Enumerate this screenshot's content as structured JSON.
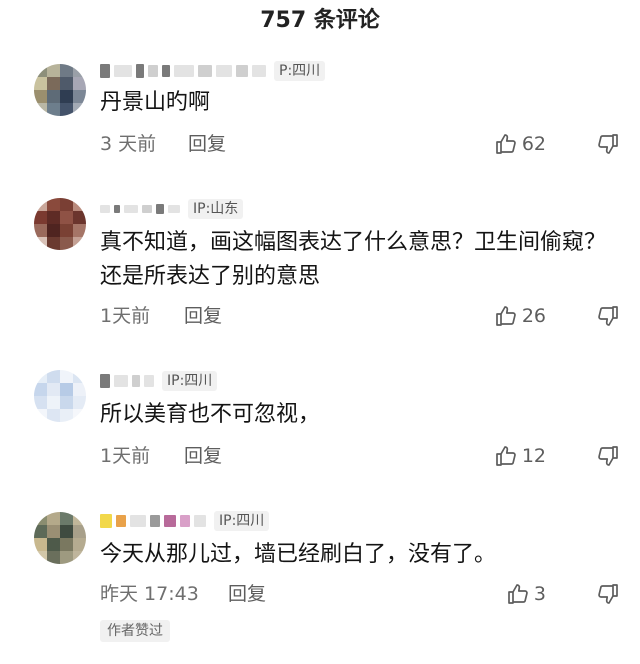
{
  "header": {
    "title": "757 条评论"
  },
  "comments": [
    {
      "ip": "P:四川",
      "text": "丹景山旳啊",
      "time": "3 天前",
      "reply_label": "回复",
      "likes": "62"
    },
    {
      "ip": "IP:山东",
      "text": "真不知道，画这幅图表达了什么意思？卫生间偷窥？还是所表达了别的意思",
      "time": "1天前",
      "reply_label": "回复",
      "likes": "26"
    },
    {
      "ip": "IP:四川",
      "text": "所以美育也不可忽视，",
      "time": "1天前",
      "reply_label": "回复",
      "likes": "12"
    },
    {
      "ip": "IP:四川",
      "text": "今天从那儿过，墙已经刷白了，没有了。",
      "time": "昨天 17:43",
      "reply_label": "回复",
      "likes": "3",
      "badge": "作者赞过"
    }
  ],
  "icons": {
    "like": "thumbs-up-icon",
    "dislike": "thumbs-down-icon"
  },
  "colors": {
    "text": "#141414",
    "secondary": "#6f6f6f",
    "badge_bg": "#f1f1f1"
  }
}
